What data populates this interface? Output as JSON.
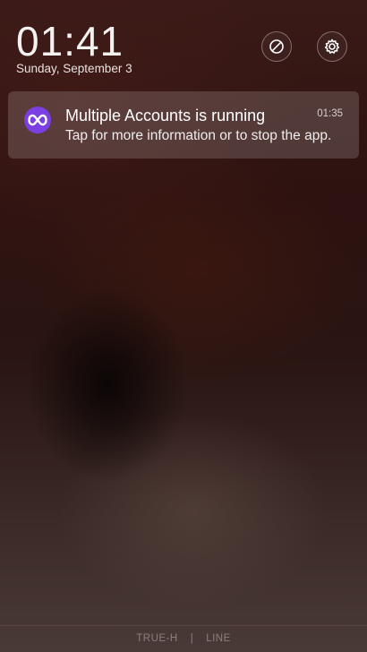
{
  "lockscreen": {
    "time": "01:41",
    "date": "Sunday, September 3"
  },
  "header_buttons": {
    "dnd_icon": "do-not-disturb-icon",
    "settings_icon": "gear-icon"
  },
  "notification": {
    "app_icon": "multiple-accounts-app-icon",
    "title": "Multiple Accounts is running",
    "time": "01:35",
    "body": "Tap for more information or to stop the app."
  },
  "carriers": {
    "sim1": "TRUE-H",
    "separator": "|",
    "sim2": "LINE"
  },
  "colors": {
    "app_icon_bg": "#7b3fe4",
    "text": "#ffffff"
  }
}
